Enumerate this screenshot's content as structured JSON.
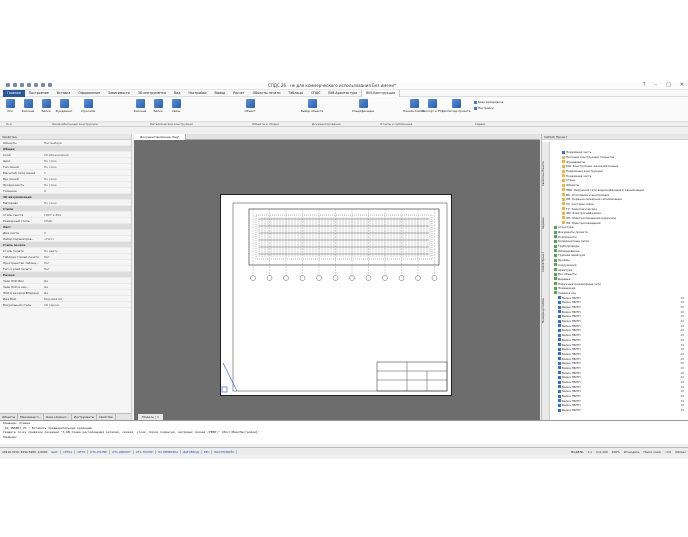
{
  "window": {
    "title": "СПДС 26 - не для коммерческого использования Без имени*",
    "controls": [
      "?",
      "–",
      "□",
      "✕"
    ]
  },
  "menu": [
    "Главная",
    "Построение",
    "Вставка",
    "Оформление",
    "Зависимости",
    "3D-инструменты",
    "Вид",
    "Настройки",
    "Вывод",
    "Расчет",
    "Объекты печати",
    "Таблицы",
    "СПДС",
    "BIM-Архитектура",
    "BIM-Конструкции"
  ],
  "ribbon": {
    "buttons": [
      "Оси",
      "Колонна",
      "Балка",
      "Фундамент",
      "Стропила",
      "Колонна",
      "Балка",
      "Связь",
      "Объект",
      "Выбор объекта",
      "Спецификации",
      "Панель CADLib",
      "Экспорт в IFC",
      "Диспетчер проекта"
    ],
    "small": [
      "База материалов",
      "Настройки"
    ],
    "groups": [
      "Оси",
      "Железобетонные конструкции",
      "Металлические конструкции",
      "Объекты и сборки",
      "Документирование",
      "Отчеты и публикация",
      "Сервис"
    ]
  },
  "properties": {
    "title": "Свойства",
    "rows": [
      {
        "k": "Объекты",
        "v": "Нет выбора",
        "sec": false
      },
      {
        "k": "Общие",
        "v": "",
        "sec": true
      },
      {
        "k": "Слой",
        "v": "20-Обозначения",
        "sec": false
      },
      {
        "k": "Цвет",
        "v": "По слою",
        "sec": false
      },
      {
        "k": "Тип линий",
        "v": "По слою",
        "sec": false
      },
      {
        "k": "Масштаб типа линий",
        "v": "1",
        "sec": false
      },
      {
        "k": "Вес линий",
        "v": "По слою",
        "sec": false
      },
      {
        "k": "Прозрачность",
        "v": "По слою",
        "sec": false
      },
      {
        "k": "Толщина",
        "v": "0",
        "sec": false
      },
      {
        "k": "3D визуализация",
        "v": "",
        "sec": true
      },
      {
        "k": "Материал",
        "v": "По слою",
        "sec": false
      },
      {
        "k": "Стили",
        "v": "",
        "sec": true
      },
      {
        "k": "Стиль текста",
        "v": "ГОСТ 2.304",
        "sec": false
      },
      {
        "k": "Размерный стиль",
        "v": "СПДС",
        "sec": false
      },
      {
        "k": "Лист",
        "v": "",
        "sec": true
      },
      {
        "k": "Имя листа",
        "v": "2",
        "sec": false
      },
      {
        "k": "Набор параметров...",
        "v": "<Нет>",
        "sec": false
      },
      {
        "k": "Стиль печати",
        "v": "",
        "sec": true
      },
      {
        "k": "Стиль печати",
        "v": "По цвету",
        "sec": false
      },
      {
        "k": "Таблица стилей печати",
        "v": "Нет",
        "sec": false
      },
      {
        "k": "Пространство таблиц...",
        "v": "Нет",
        "sec": false
      },
      {
        "k": "Тип стилей печати",
        "v": "Нет",
        "sec": false
      },
      {
        "k": "Разное",
        "v": "",
        "sec": true
      },
      {
        "k": "Знак ПСК Вкл",
        "v": "Да",
        "sec": false
      },
      {
        "k": "Знак ПСК в нач...",
        "v": "Да",
        "sec": false
      },
      {
        "k": "ПСК в каждом ВЭкране",
        "v": "Да",
        "sec": false
      },
      {
        "k": "Имя ПСК",
        "v": "Мировая СК",
        "sec": false
      },
      {
        "k": "Визуальный стиль",
        "v": "2D каркас",
        "sec": false
      }
    ],
    "tabs": [
      "Объекты",
      "Менеджер п...",
      "База элемент...",
      "Инструменты",
      "Свойства"
    ]
  },
  "document": {
    "tab": "Документирование.dwg*",
    "model_tab": "Модель",
    "model_tab_2": "1"
  },
  "cadlib": {
    "title": "CADLib Проект",
    "vtabs": [
      "Свойства объекта",
      "Задание",
      "CADLib Проект",
      "Менеджер CADLib"
    ],
    "tree": [
      {
        "label": "Подземная часть",
        "icon": "b",
        "num": ""
      },
      {
        "label": "Несущие конструкции покрытия",
        "icon": "y",
        "num": ""
      },
      {
        "label": "Фундаменты",
        "icon": "y",
        "num": ""
      },
      {
        "label": "КЖ. Конструкции железобетонные",
        "icon": "y",
        "num": ""
      },
      {
        "label": "Надземные конструкции",
        "icon": "y",
        "num": ""
      },
      {
        "label": "Подземная часть",
        "icon": "y",
        "num": ""
      },
      {
        "label": "Стены",
        "icon": "y",
        "num": ""
      },
      {
        "label": "Объекты",
        "icon": "y",
        "num": ""
      },
      {
        "label": "НВК. Наружные сети водоснабжения и канализации",
        "icon": "y",
        "num": ""
      },
      {
        "label": "ВК. Отопление и вентиляция",
        "icon": "y",
        "num": ""
      },
      {
        "label": "ОВ. Охранно-пожарная сигнализация",
        "icon": "y",
        "num": ""
      },
      {
        "label": "СС. Системы связи",
        "icon": "y",
        "num": ""
      },
      {
        "label": "ТХ. Технологические",
        "icon": "y",
        "num": ""
      },
      {
        "label": "ЭМ. Электроснабжение",
        "icon": "y",
        "num": ""
      },
      {
        "label": "ЭН. Электроосвещение наружное",
        "icon": "y",
        "num": ""
      },
      {
        "label": "ЭО. Электроосвещение",
        "icon": "y",
        "num": ""
      },
      {
        "label": "Структура",
        "icon": "g",
        "num": ""
      },
      {
        "label": "Документы проекта",
        "icon": "g",
        "num": ""
      },
      {
        "label": "Компоненты",
        "icon": "g",
        "num": ""
      },
      {
        "label": "Координатные сетки",
        "icon": "g",
        "num": ""
      },
      {
        "label": "Трубопроводы",
        "icon": "g",
        "num": ""
      },
      {
        "label": "Оборудование",
        "icon": "g",
        "num": ""
      },
      {
        "label": "Трубная арматура",
        "icon": "g",
        "num": ""
      },
      {
        "label": "Проемы",
        "icon": "g",
        "num": ""
      },
      {
        "label": "Сооружения",
        "icon": "g",
        "num": ""
      },
      {
        "label": "Арматура",
        "icon": "g",
        "num": ""
      },
      {
        "label": "Все объекты",
        "icon": "g",
        "num": ""
      },
      {
        "label": "Деревья",
        "icon": "g",
        "num": ""
      },
      {
        "label": "Наружные инженерные сети",
        "icon": "g",
        "num": ""
      },
      {
        "label": "Помещения",
        "icon": "g",
        "num": ""
      },
      {
        "label": "Сервиса зон",
        "icon": "g",
        "num": ""
      },
      {
        "label": "Балка ПБ/ТП",
        "icon": "b",
        "num": "48"
      },
      {
        "label": "Балка ПБ/ТП",
        "icon": "b",
        "num": "48"
      },
      {
        "label": "Балка ПБ/ТП",
        "icon": "b",
        "num": "48"
      },
      {
        "label": "Балка ПБ/ТП",
        "icon": "b",
        "num": "48"
      },
      {
        "label": "Балка ПБ/ТП",
        "icon": "b",
        "num": "48"
      },
      {
        "label": "Балка ПБ/ТП",
        "icon": "b",
        "num": "48"
      },
      {
        "label": "Балка ПБ/ТП",
        "icon": "b",
        "num": "48"
      },
      {
        "label": "Балка ПБ/ТП",
        "icon": "b",
        "num": "48"
      },
      {
        "label": "Балка ПБ/ТП",
        "icon": "b",
        "num": "48"
      },
      {
        "label": "Балка ПБ/ТП",
        "icon": "b",
        "num": "48"
      },
      {
        "label": "Балка ПБ/ТП",
        "icon": "b",
        "num": "48"
      },
      {
        "label": "Балка ПБ/ТП",
        "icon": "b",
        "num": "48"
      },
      {
        "label": "Балка ПБ/ТП",
        "icon": "b",
        "num": "48"
      },
      {
        "label": "Балка ПБ/ТП",
        "icon": "b",
        "num": "48"
      },
      {
        "label": "Балка ПБ/ТП",
        "icon": "b",
        "num": "48"
      },
      {
        "label": "Балка ПБ/ТП",
        "icon": "b",
        "num": "48"
      },
      {
        "label": "Балка ПБ/ТП",
        "icon": "b",
        "num": "48"
      },
      {
        "label": "Балка ПБ/ТП",
        "icon": "b",
        "num": "48"
      },
      {
        "label": "Балка ПБ/ТП",
        "icon": "b",
        "num": "48"
      },
      {
        "label": "Балка ПБ/ТП",
        "icon": "b",
        "num": "48"
      },
      {
        "label": "Балка ПБ/ТП",
        "icon": "b",
        "num": "48"
      },
      {
        "label": "Балка ПБ/ТП",
        "icon": "b",
        "num": "48"
      },
      {
        "label": "Балка ПБ/ТП",
        "icon": "b",
        "num": "48"
      },
      {
        "label": "Балка ПБ/ТП",
        "icon": "b",
        "num": "48"
      },
      {
        "label": "Балка ПБ/ТП",
        "icon": "b",
        "num": "48"
      }
    ]
  },
  "command": {
    "lines": [
      "Команда: Отмена",
      "",
      "_SQ_INSERT_VS : Вставить предварительную проекцию",
      "Укажите точку привязки проекции \"3_КЖ_Схема расположения ригелей, связей, стоек, балок покрытия, ветровых связей (РЕ80)\" [Лист/Вид/Настройки]:",
      "Команда:"
    ]
  },
  "status": {
    "coords": "43916.3010, 8290.5980, 0.0000",
    "items": [
      "ШАГ",
      "СЕТКА",
      "ОРТО",
      "ОТС-ПОЛЯР",
      "ОТС-ОБЪЕКТ",
      "ОТС-ПОЛЯР",
      "3D-ПРИВЯЗКА",
      "ДИН-ВВОД",
      "ВЕС",
      "БЫСТРСВОЙС"
    ],
    "right": [
      "МОДЕЛЬ",
      "1:1",
      "m/1:100",
      "100%",
      "2D модель",
      "Поиск комп.",
      "сСО",
      "Облако"
    ]
  }
}
